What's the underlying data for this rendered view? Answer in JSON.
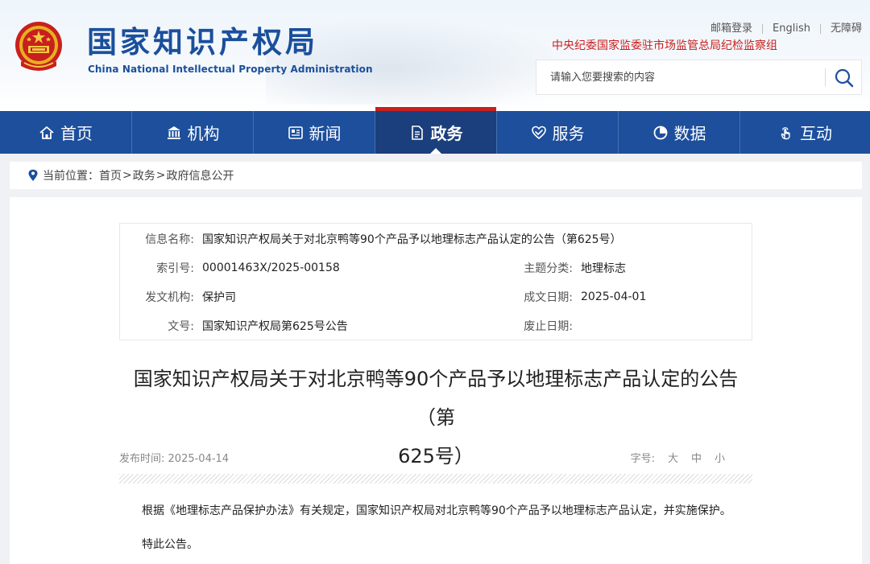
{
  "header": {
    "logo_cn": "国家知识产权局",
    "logo_en": "China National Intellectual Property Administration",
    "emblem_icon": "national-emblem-icon",
    "top_links": [
      "邮箱登录",
      "English",
      "无障碍"
    ],
    "discipline_link": "中央纪委国家监委驻市场监管总局纪检监察组",
    "search": {
      "placeholder": "请输入您要搜索的内容",
      "icon": "search-icon"
    }
  },
  "nav": {
    "items": [
      {
        "label": "首页",
        "icon": "home-icon"
      },
      {
        "label": "机构",
        "icon": "building-icon"
      },
      {
        "label": "新闻",
        "icon": "newspaper-icon"
      },
      {
        "label": "政务",
        "icon": "document-icon",
        "active": true
      },
      {
        "label": "服务",
        "icon": "heart-hand-icon"
      },
      {
        "label": "数据",
        "icon": "pie-chart-icon"
      },
      {
        "label": "互动",
        "icon": "touch-icon"
      }
    ]
  },
  "breadcrumb": {
    "label": "当前位置：",
    "items": [
      "首页",
      "政务",
      "政府信息公开"
    ],
    "separator": ">"
  },
  "info": {
    "name_label": "信息名称:",
    "name_value": "国家知识产权局关于对北京鸭等90个产品予以地理标志产品认定的公告（第625号）",
    "index_label": "索引号:",
    "index_value": "00001463X/2025-00158",
    "topic_label": "主题分类:",
    "topic_value": "地理标志",
    "issuer_label": "发文机构:",
    "issuer_value": "保护司",
    "date_label": "成文日期:",
    "date_value": "2025-04-01",
    "docno_label": "文号:",
    "docno_value": "国家知识产权局第625号公告",
    "expire_label": "废止日期:",
    "expire_value": ""
  },
  "article": {
    "title_line1": "国家知识产权局关于对北京鸭等90个产品予以地理标志产品认定的公告（第",
    "title_line2": "625号）",
    "publish_label": "发布时间:",
    "publish_date": "2025-04-14",
    "font_size_label": "字号:",
    "font_sizes": [
      "大",
      "中",
      "小"
    ],
    "paragraphs": [
      "根据《地理标志产品保护办法》有关规定，国家知识产权局对北京鸭等90个产品予以地理标志产品认定，并实施保护。",
      "特此公告。"
    ]
  },
  "colors": {
    "brand_blue": "#1d4f9c",
    "active_nav": "#1a3f7c",
    "accent_red": "#c8201e"
  }
}
